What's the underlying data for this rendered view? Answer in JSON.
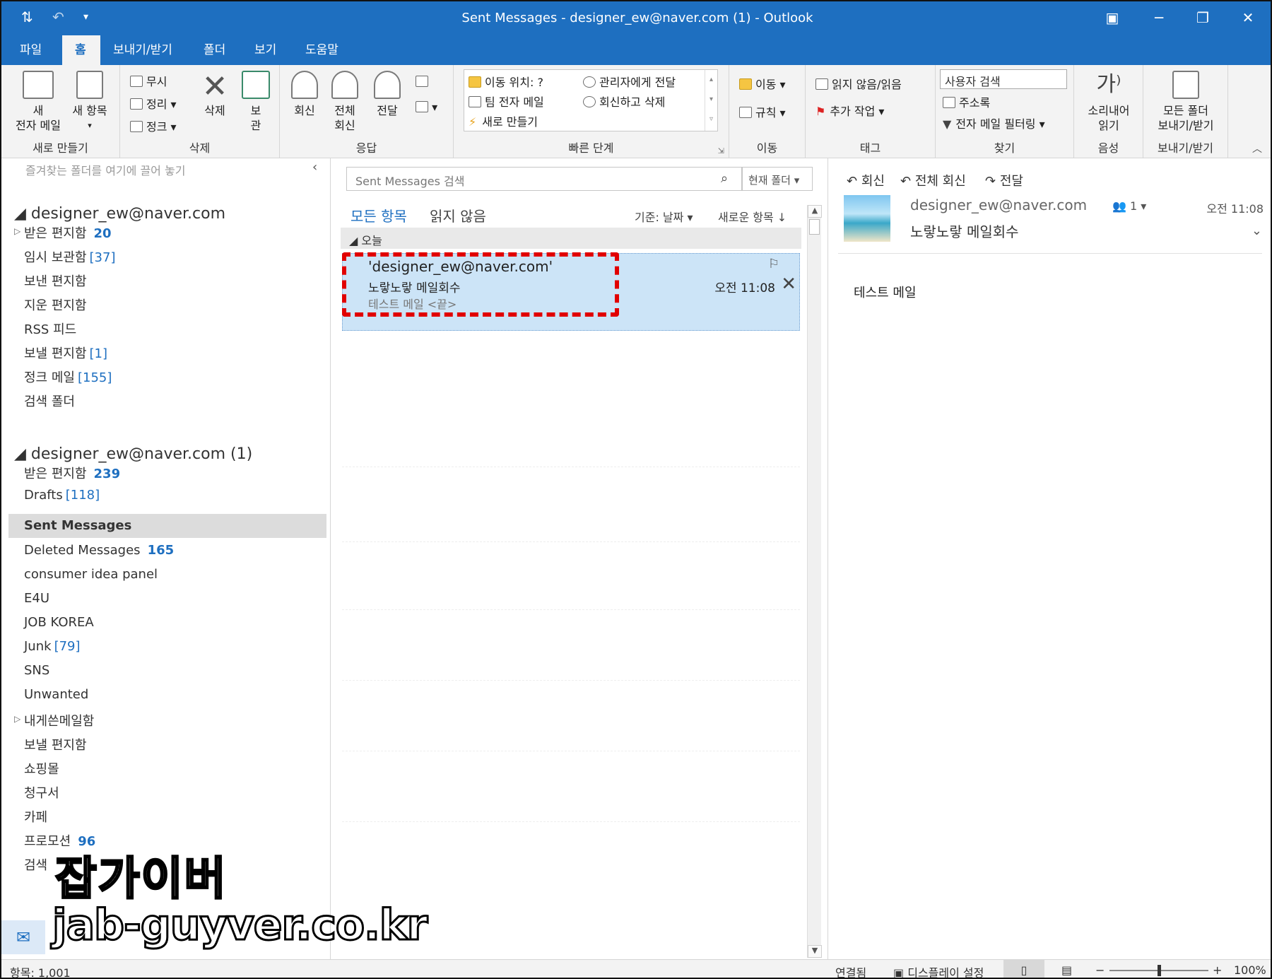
{
  "window": {
    "title": "Sent Messages - designer_ew@naver.com (1)  -  Outlook"
  },
  "menu_tabs": [
    "파일",
    "홈",
    "보내기/받기",
    "폴더",
    "보기",
    "도움말"
  ],
  "active_tab": "홈",
  "ribbon": {
    "groups": {
      "new": "새로 만들기",
      "delete": "삭제",
      "respond": "응답",
      "quicksteps": "빠른 단계",
      "move": "이동",
      "tags": "태그",
      "find": "찾기",
      "speech": "음성",
      "sendrecv": "보내기/받기"
    },
    "new_email": "새\n전자 메일",
    "new_email_l1": "새",
    "new_email_l2": "전자 메일",
    "new_items": "새 항목",
    "ignore": "무시",
    "cleanup": "정리",
    "junk": "정크",
    "delete": "삭제",
    "archive_l1": "보",
    "archive_l2": "관",
    "reply": "회신",
    "reply_all_l1": "전체",
    "reply_all_l2": "회신",
    "forward": "전달",
    "qs_moveto": "이동 위치: ?",
    "qs_team": "팀 전자 메일",
    "qs_new": "새로 만들기",
    "qs_tomanager": "관리자에게 전달",
    "qs_replydelete": "회신하고 삭제",
    "move": "이동",
    "rules": "규칙",
    "unread_read": "읽지 않음/읽음",
    "followup": "추가 작업",
    "search_people": "사용자 검색",
    "address_book": "주소록",
    "filter_email": "전자 메일 필터링",
    "read_aloud_l1": "소리내어",
    "read_aloud_l2": "읽기",
    "sendrecv_all_l1": "모든 폴더",
    "sendrecv_all_l2": "보내기/받기"
  },
  "folders": {
    "fav_hint": "즐겨찾는 폴더를 여기에 끌어 놓기",
    "account1": {
      "name": "designer_ew@naver.com",
      "items": [
        {
          "label": "받은 편지함",
          "count": "20"
        },
        {
          "label": "임시 보관함",
          "bracket": "[37]"
        },
        {
          "label": "보낸 편지함"
        },
        {
          "label": "지운 편지함"
        },
        {
          "label": "RSS 피드"
        },
        {
          "label": "보낼 편지함",
          "bracket": "[1]"
        },
        {
          "label": "정크 메일",
          "bracket": "[155]"
        },
        {
          "label": "검색 폴더"
        }
      ]
    },
    "account2": {
      "name": "designer_ew@naver.com (1)",
      "items": [
        {
          "label": "받은 편지함",
          "count": "239"
        },
        {
          "label": "Drafts",
          "bracket": "[118]"
        },
        {
          "label": "Sent Messages"
        },
        {
          "label": "Deleted Messages",
          "count": "165"
        },
        {
          "label": "consumer idea panel"
        },
        {
          "label": "E4U"
        },
        {
          "label": "JOB KOREA"
        },
        {
          "label": "Junk",
          "bracket": "[79]"
        },
        {
          "label": "SNS"
        },
        {
          "label": "Unwanted"
        },
        {
          "label": "내게쓴메일함"
        },
        {
          "label": "보낼 편지함"
        },
        {
          "label": "쇼핑몰"
        },
        {
          "label": "청구서"
        },
        {
          "label": "카페"
        },
        {
          "label": "프로모션",
          "count": "96"
        },
        {
          "label": "검색"
        }
      ]
    }
  },
  "list": {
    "search_placeholder": "Sent Messages 검색",
    "scope": "현재 폴더",
    "tab_all": "모든 항목",
    "tab_unread": "읽지 않음",
    "sort_by": "기준: 날짜",
    "sort_order": "새로운 항목 ↓",
    "group": "오늘",
    "message": {
      "from": "'designer_ew@naver.com'",
      "subject": "노랗노랗 메일회수",
      "preview": "테스트 메일 <끝>",
      "time": "오전 11:08"
    }
  },
  "reading": {
    "reply": "회신",
    "reply_all": "전체 회신",
    "forward": "전달",
    "from": "designer_ew@naver.com",
    "people_count": "1",
    "time": "오전 11:08",
    "subject": "노랗노랗 메일회수",
    "body": "테스트 메일"
  },
  "status": {
    "items": "항목: 1,001",
    "connection": "연결됨",
    "display_settings": "디스플레이 설정",
    "zoom": "100%"
  },
  "watermark": {
    "line1": "잡가이버",
    "line2": "jab-guyver.co.kr"
  },
  "colors": {
    "accent": "#1e6fc0",
    "selected_row": "#cce4f7",
    "highlight_box": "#e10000"
  }
}
